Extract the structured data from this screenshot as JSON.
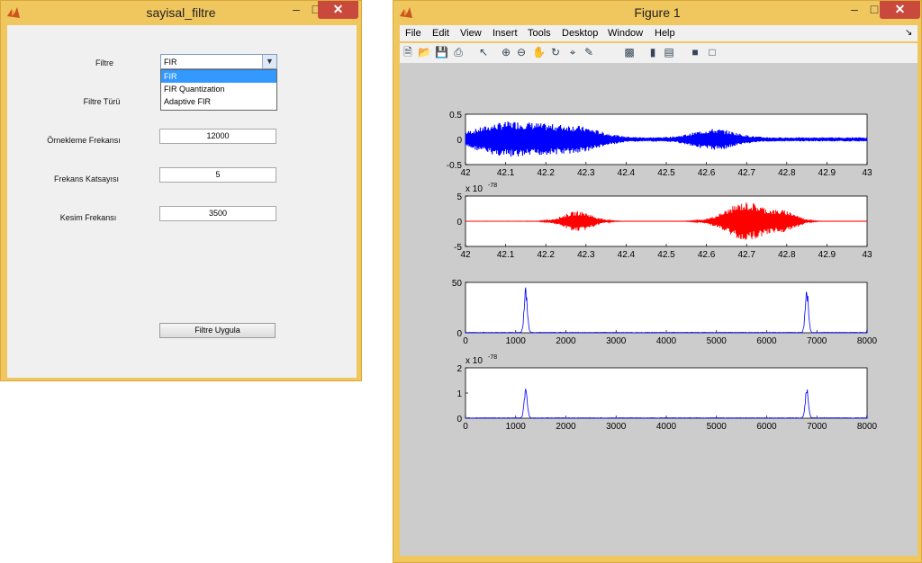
{
  "left_window": {
    "title": "sayisal_filtre",
    "controls": {
      "minimize": "–",
      "maximize": "□",
      "close": "✕"
    },
    "filtre_label": "Filtre",
    "filtre_selected": "FIR",
    "filtre_options": [
      "FIR",
      "FIR Quantization",
      "Adaptive FIR"
    ],
    "filtre_turu_label": "Filtre Türü",
    "ornekleme_label": "Örnekleme Frekansı",
    "ornekleme_value": "12000",
    "katsayi_label": "Frekans Katsayısı",
    "katsayi_value": "5",
    "kesim_label": "Kesim Frekansı",
    "kesim_value": "3500",
    "apply_button": "Filtre Uygula"
  },
  "right_window": {
    "title": "Figure 1",
    "controls": {
      "minimize": "–",
      "maximize": "□",
      "close": "✕"
    },
    "menu": [
      "File",
      "Edit",
      "View",
      "Insert",
      "Tools",
      "Desktop",
      "Window",
      "Help"
    ],
    "menu_arrow": "↘",
    "toolbar_icons": [
      "new-file-icon",
      "open-folder-icon",
      "save-icon",
      "print-icon",
      "pointer-icon",
      "zoom-in-icon",
      "zoom-out-icon",
      "pan-hand-icon",
      "rotate-icon",
      "data-cursor-icon",
      "brush-icon",
      "link-icon",
      "colorbar-icon",
      "legend-icon",
      "hide-tools-icon",
      "show-tools-icon"
    ]
  },
  "colors": {
    "signal_blue": "#0000ff",
    "signal_red": "#ff0000",
    "accent": "#f0c75e"
  },
  "chart_data": [
    {
      "type": "line",
      "series": [
        {
          "name": "",
          "color": "#0000ff"
        }
      ],
      "xlim": [
        42,
        43
      ],
      "ylim": [
        -0.5,
        0.5
      ],
      "xticks": [
        "42",
        "42.1",
        "42.2",
        "42.3",
        "42.4",
        "42.5",
        "42.6",
        "42.7",
        "42.8",
        "42.9",
        "43"
      ],
      "yticks": [
        "0.5",
        "0",
        "-0.5"
      ],
      "exponent": ""
    },
    {
      "type": "line",
      "series": [
        {
          "name": "",
          "color": "#ff0000"
        }
      ],
      "xlim": [
        42,
        43
      ],
      "ylim": [
        -5,
        5
      ],
      "xticks": [
        "42",
        "42.1",
        "42.2",
        "42.3",
        "42.4",
        "42.5",
        "42.6",
        "42.7",
        "42.8",
        "42.9",
        "43"
      ],
      "yticks": [
        "5",
        "0",
        "-5"
      ],
      "exponent": "x 10",
      "exponent_power": "-78"
    },
    {
      "type": "line",
      "series": [
        {
          "name": "",
          "color": "#0000ff"
        }
      ],
      "xlim": [
        0,
        8000
      ],
      "ylim": [
        0,
        50
      ],
      "xticks": [
        "0",
        "1000",
        "2000",
        "3000",
        "4000",
        "5000",
        "6000",
        "7000",
        "8000"
      ],
      "yticks": [
        "50",
        "0"
      ],
      "peaks": [
        1200,
        6800
      ],
      "peak_value": 45,
      "exponent": ""
    },
    {
      "type": "line",
      "series": [
        {
          "name": "",
          "color": "#0000ff"
        }
      ],
      "xlim": [
        0,
        8000
      ],
      "ylim": [
        0,
        2
      ],
      "xticks": [
        "0",
        "1000",
        "2000",
        "3000",
        "4000",
        "5000",
        "6000",
        "7000",
        "8000"
      ],
      "yticks": [
        "2",
        "1",
        "0"
      ],
      "peaks": [
        1200,
        6800
      ],
      "peak_value": 1.2,
      "exponent": "x 10",
      "exponent_power": "-78"
    }
  ]
}
